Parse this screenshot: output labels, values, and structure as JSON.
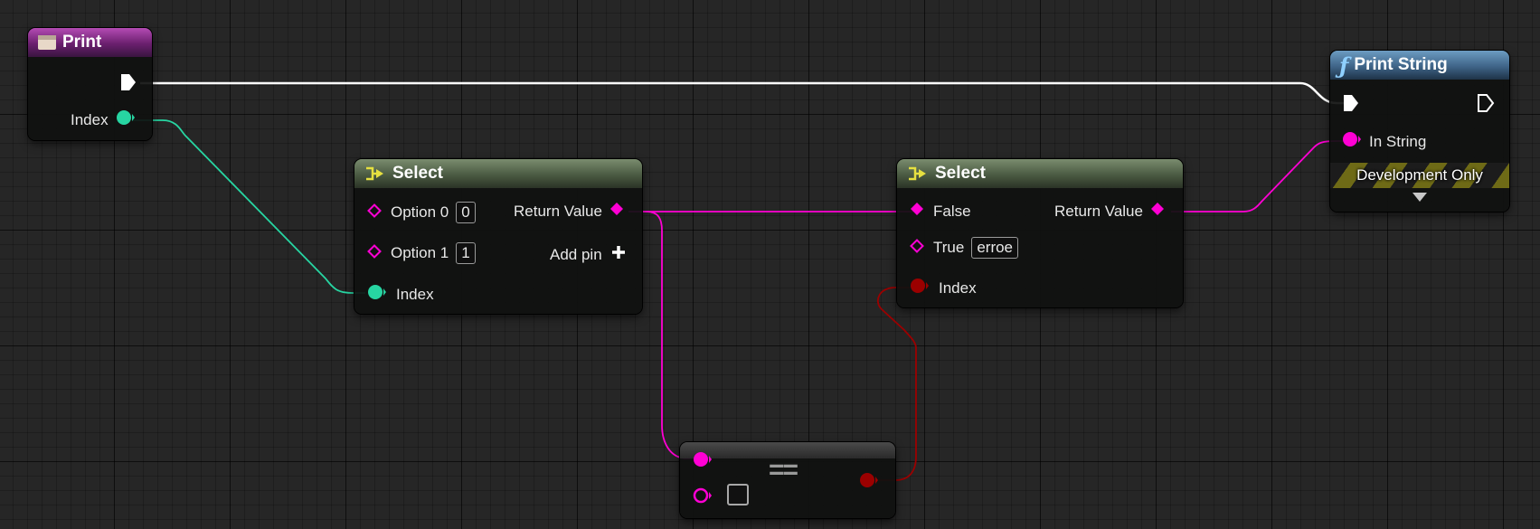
{
  "nodes": {
    "print_event": {
      "title": "Print",
      "pins": {
        "index_label": "Index"
      }
    },
    "select_1": {
      "title": "Select",
      "pins": {
        "option0_label": "Option 0",
        "option0_value": "0",
        "option1_label": "Option 1",
        "option1_value": "1",
        "index_label": "Index",
        "return_label": "Return Value",
        "add_pin_label": "Add pin"
      }
    },
    "select_2": {
      "title": "Select",
      "pins": {
        "false_label": "False",
        "true_label": "True",
        "true_value": "erroe",
        "index_label": "Index",
        "return_label": "Return Value"
      }
    },
    "print_string": {
      "title": "Print String",
      "pins": {
        "in_string_label": "In String",
        "dev_only_label": "Development Only"
      }
    },
    "equals": {
      "symbol": "=="
    }
  },
  "colors": {
    "exec_wire": "#ffffff",
    "int_wire": "#27d5a2",
    "string_wire": "#ff00d4",
    "bool_pin": "#9b0000",
    "string_pin": "#ff00d4",
    "int_pin": "#27d5a2"
  },
  "icons": {
    "print_event": "event-icon",
    "select": "select-icon",
    "print_string": "function-icon",
    "add_pin": "plus-icon"
  }
}
